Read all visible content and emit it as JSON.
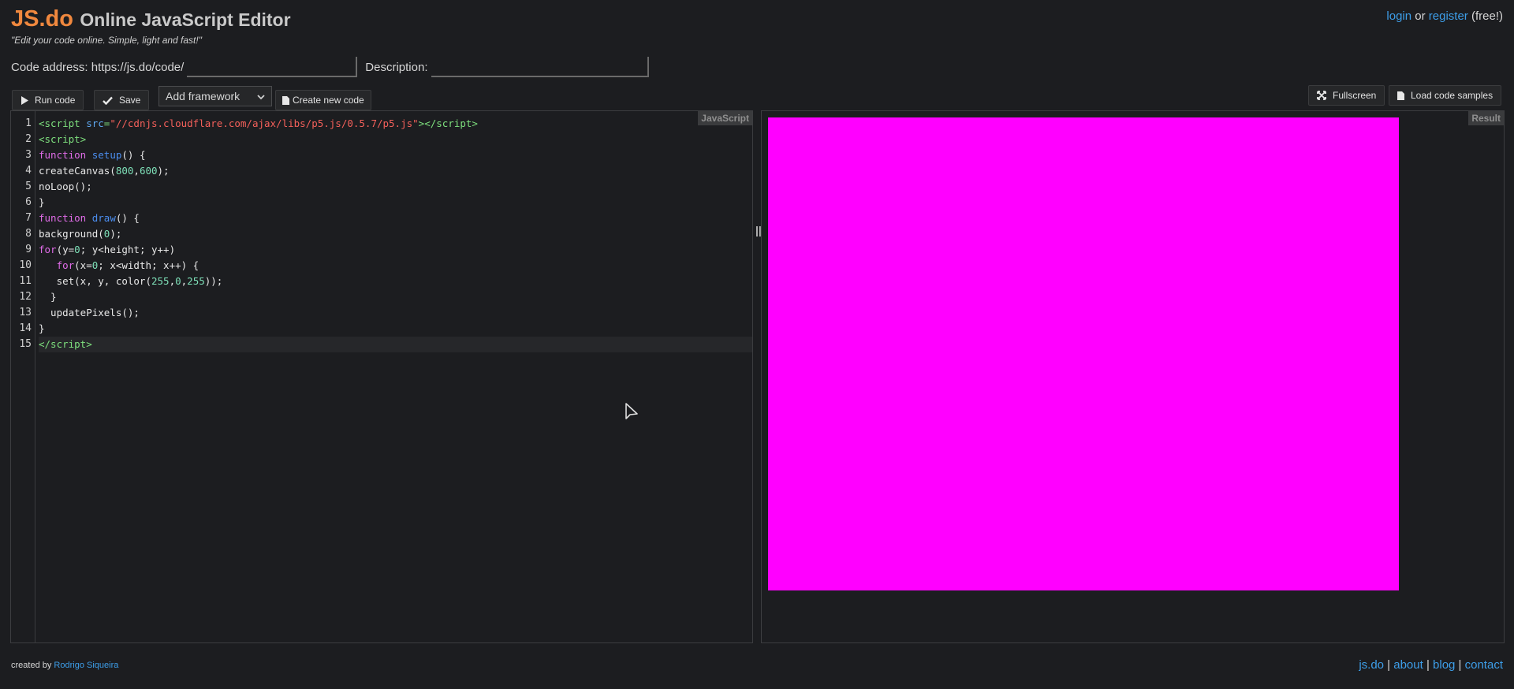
{
  "header": {
    "logo": "JS.do",
    "title": "Online JavaScript Editor",
    "tagline": "\"Edit your code online. Simple, light and fast!\"",
    "login_label": "login",
    "or_text": " or ",
    "register_label": "register",
    "free_text": " (free!)"
  },
  "address_row": {
    "code_address_label": "Code address: https://js.do/code/",
    "code_address_value": "",
    "description_label": "Description:",
    "description_value": ""
  },
  "toolbar": {
    "run_label": "Run code",
    "save_label": "Save",
    "framework_selected": "Add framework",
    "create_label": "Create new code",
    "fullscreen_label": "Fullscreen",
    "load_samples_label": "Load code samples"
  },
  "editor": {
    "language_tag": "JavaScript",
    "line_numbers": [
      "1",
      "2",
      "3",
      "4",
      "5",
      "6",
      "7",
      "8",
      "9",
      "10",
      "11",
      "12",
      "13",
      "14",
      "15"
    ]
  },
  "result": {
    "tag": "Result",
    "canvas_color": "#ff00ff"
  },
  "footer": {
    "created_by": "created by ",
    "author": "Rodrigo Siqueira",
    "links": [
      "js.do",
      "about",
      "blog",
      "contact"
    ],
    "sep": " | "
  },
  "colors": {
    "background": "#1c1d20",
    "accent": "#f0883e",
    "link": "#3d9ee9"
  }
}
